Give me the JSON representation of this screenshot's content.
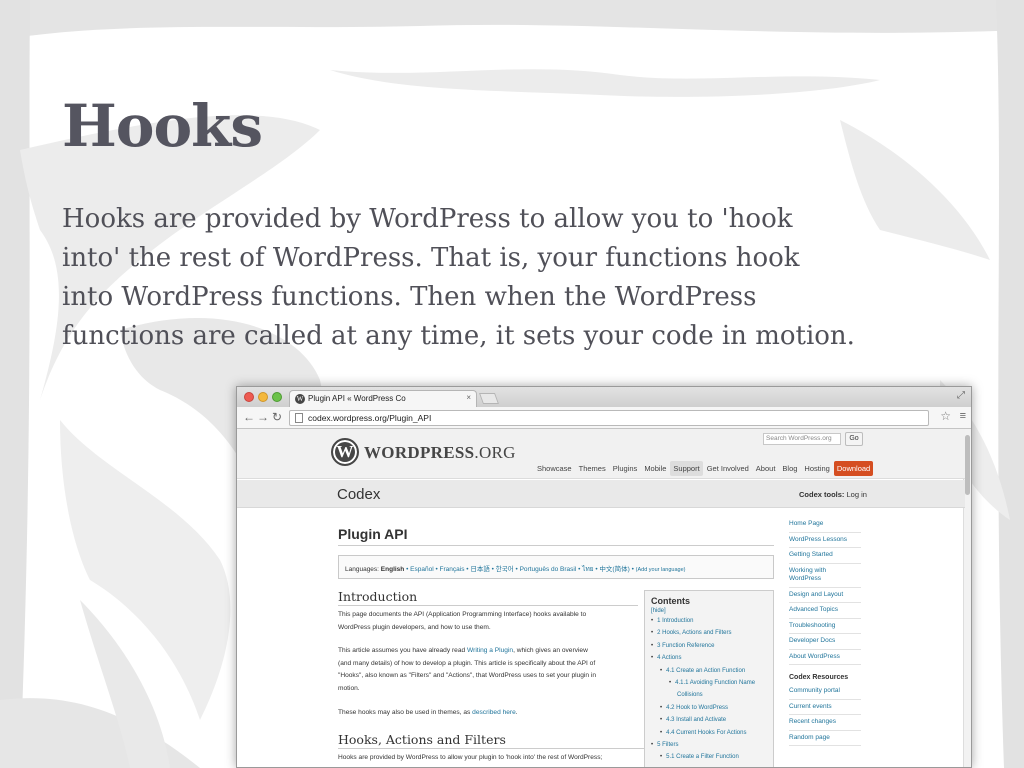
{
  "slide": {
    "title": "Hooks",
    "body_lines": [
      "Hooks are provided by WordPress to allow you to 'hook",
      "into' the rest of WordPress. That is, your functions hook",
      "into WordPress functions. Then when the WordPress",
      "functions are called at any time, it sets your code in motion."
    ]
  },
  "browser": {
    "tab_title": "Plugin API « WordPress Co",
    "tab_close": "×",
    "url": "codex.wordpress.org/Plugin_API",
    "icons": {
      "back": "back-arrow-icon",
      "forward": "forward-arrow-icon",
      "reload": "reload-icon",
      "star": "star-icon",
      "menu": "menu-icon"
    }
  },
  "wp": {
    "logo_letter": "W",
    "wordmark_bold": "WORDPRESS",
    "wordmark_light": ".ORG",
    "search_placeholder": "Search WordPress.org",
    "go_label": "Go",
    "nav": [
      "Showcase",
      "Themes",
      "Plugins",
      "Mobile",
      "Support",
      "Get Involved",
      "About",
      "Blog",
      "Hosting",
      "Download"
    ],
    "accent": "#d54e21",
    "link_color": "#21759b"
  },
  "codex": {
    "title": "Codex",
    "tools_label": "Codex tools:",
    "tools_link": "Log in"
  },
  "page": {
    "title": "Plugin API",
    "languages_prefix": "Languages:",
    "languages_current": "English",
    "languages_rest": " • Español • Français • 日本語 • 한국어 • Português do Brasil • ไทย • 中文(简体) • ",
    "languages_add": "(Add your language)",
    "intro_heading": "Introduction",
    "p1": [
      "This page documents the API (Application Programming Interface) hooks available to",
      "WordPress plugin developers, and how to use them."
    ],
    "p2_line1_before": "This article assumes you have already read ",
    "p2_link": "Writing a Plugin",
    "p2_line1_after": ", which gives an overview",
    "p2_rest": [
      "(and many details) of how to develop a plugin. This article is specifically about the API of",
      "\"Hooks\", also known as \"Filters\" and \"Actions\", that WordPress uses to set your plugin in",
      "motion."
    ],
    "p3_before": "These hooks may also be used in themes, as ",
    "p3_link": "described here",
    "p3_after": ".",
    "hooks_heading": "Hooks, Actions and Filters",
    "p4": [
      "Hooks are provided by WordPress to allow your plugin to 'hook into' the rest of WordPress;"
    ]
  },
  "toc": {
    "title": "Contents",
    "hide": "[hide]",
    "items": [
      {
        "label": "1 Introduction",
        "level": 1
      },
      {
        "label": "2 Hooks, Actions and Filters",
        "level": 1
      },
      {
        "label": "3 Function Reference",
        "level": 1
      },
      {
        "label": "4 Actions",
        "level": 1
      },
      {
        "label": "4.1 Create an Action Function",
        "level": 2
      },
      {
        "label": "4.1.1 Avoiding Function Name",
        "level": 3
      },
      {
        "label": "Collisions",
        "level": 4
      },
      {
        "label": "4.2 Hook to WordPress",
        "level": 2
      },
      {
        "label": "4.3 Install and Activate",
        "level": 2
      },
      {
        "label": "4.4 Current Hooks For Actions",
        "level": 2
      },
      {
        "label": "5 Filters",
        "level": 1
      },
      {
        "label": "5.1 Create a Filter Function",
        "level": 2
      }
    ]
  },
  "sidebar": {
    "links": [
      [
        "Home Page"
      ],
      [
        "WordPress Lessons"
      ],
      [
        "Getting Started"
      ],
      [
        "Working with",
        "WordPress"
      ],
      [
        "Design and Layout"
      ],
      [
        "Advanced Topics"
      ],
      [
        "Troubleshooting"
      ],
      [
        "Developer Docs"
      ],
      [
        "About WordPress"
      ]
    ],
    "resources_heading": "Codex Resources",
    "resources": [
      [
        "Community portal"
      ],
      [
        "Current events"
      ],
      [
        "Recent changes"
      ],
      [
        "Random page"
      ]
    ]
  }
}
